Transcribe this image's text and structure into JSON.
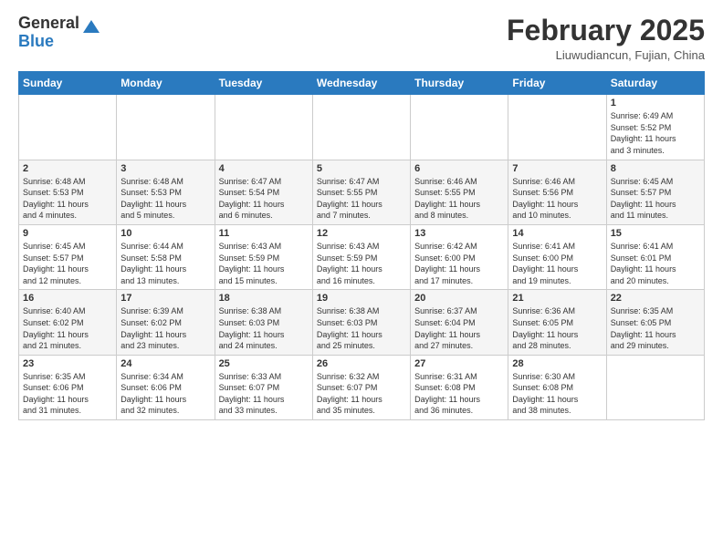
{
  "header": {
    "logo_line1": "General",
    "logo_line2": "Blue",
    "month_title": "February 2025",
    "location": "Liuwudiancun, Fujian, China"
  },
  "days_of_week": [
    "Sunday",
    "Monday",
    "Tuesday",
    "Wednesday",
    "Thursday",
    "Friday",
    "Saturday"
  ],
  "weeks": [
    [
      {
        "num": "",
        "info": ""
      },
      {
        "num": "",
        "info": ""
      },
      {
        "num": "",
        "info": ""
      },
      {
        "num": "",
        "info": ""
      },
      {
        "num": "",
        "info": ""
      },
      {
        "num": "",
        "info": ""
      },
      {
        "num": "1",
        "info": "Sunrise: 6:49 AM\nSunset: 5:52 PM\nDaylight: 11 hours\nand 3 minutes."
      }
    ],
    [
      {
        "num": "2",
        "info": "Sunrise: 6:48 AM\nSunset: 5:53 PM\nDaylight: 11 hours\nand 4 minutes."
      },
      {
        "num": "3",
        "info": "Sunrise: 6:48 AM\nSunset: 5:53 PM\nDaylight: 11 hours\nand 5 minutes."
      },
      {
        "num": "4",
        "info": "Sunrise: 6:47 AM\nSunset: 5:54 PM\nDaylight: 11 hours\nand 6 minutes."
      },
      {
        "num": "5",
        "info": "Sunrise: 6:47 AM\nSunset: 5:55 PM\nDaylight: 11 hours\nand 7 minutes."
      },
      {
        "num": "6",
        "info": "Sunrise: 6:46 AM\nSunset: 5:55 PM\nDaylight: 11 hours\nand 8 minutes."
      },
      {
        "num": "7",
        "info": "Sunrise: 6:46 AM\nSunset: 5:56 PM\nDaylight: 11 hours\nand 10 minutes."
      },
      {
        "num": "8",
        "info": "Sunrise: 6:45 AM\nSunset: 5:57 PM\nDaylight: 11 hours\nand 11 minutes."
      }
    ],
    [
      {
        "num": "9",
        "info": "Sunrise: 6:45 AM\nSunset: 5:57 PM\nDaylight: 11 hours\nand 12 minutes."
      },
      {
        "num": "10",
        "info": "Sunrise: 6:44 AM\nSunset: 5:58 PM\nDaylight: 11 hours\nand 13 minutes."
      },
      {
        "num": "11",
        "info": "Sunrise: 6:43 AM\nSunset: 5:59 PM\nDaylight: 11 hours\nand 15 minutes."
      },
      {
        "num": "12",
        "info": "Sunrise: 6:43 AM\nSunset: 5:59 PM\nDaylight: 11 hours\nand 16 minutes."
      },
      {
        "num": "13",
        "info": "Sunrise: 6:42 AM\nSunset: 6:00 PM\nDaylight: 11 hours\nand 17 minutes."
      },
      {
        "num": "14",
        "info": "Sunrise: 6:41 AM\nSunset: 6:00 PM\nDaylight: 11 hours\nand 19 minutes."
      },
      {
        "num": "15",
        "info": "Sunrise: 6:41 AM\nSunset: 6:01 PM\nDaylight: 11 hours\nand 20 minutes."
      }
    ],
    [
      {
        "num": "16",
        "info": "Sunrise: 6:40 AM\nSunset: 6:02 PM\nDaylight: 11 hours\nand 21 minutes."
      },
      {
        "num": "17",
        "info": "Sunrise: 6:39 AM\nSunset: 6:02 PM\nDaylight: 11 hours\nand 23 minutes."
      },
      {
        "num": "18",
        "info": "Sunrise: 6:38 AM\nSunset: 6:03 PM\nDaylight: 11 hours\nand 24 minutes."
      },
      {
        "num": "19",
        "info": "Sunrise: 6:38 AM\nSunset: 6:03 PM\nDaylight: 11 hours\nand 25 minutes."
      },
      {
        "num": "20",
        "info": "Sunrise: 6:37 AM\nSunset: 6:04 PM\nDaylight: 11 hours\nand 27 minutes."
      },
      {
        "num": "21",
        "info": "Sunrise: 6:36 AM\nSunset: 6:05 PM\nDaylight: 11 hours\nand 28 minutes."
      },
      {
        "num": "22",
        "info": "Sunrise: 6:35 AM\nSunset: 6:05 PM\nDaylight: 11 hours\nand 29 minutes."
      }
    ],
    [
      {
        "num": "23",
        "info": "Sunrise: 6:35 AM\nSunset: 6:06 PM\nDaylight: 11 hours\nand 31 minutes."
      },
      {
        "num": "24",
        "info": "Sunrise: 6:34 AM\nSunset: 6:06 PM\nDaylight: 11 hours\nand 32 minutes."
      },
      {
        "num": "25",
        "info": "Sunrise: 6:33 AM\nSunset: 6:07 PM\nDaylight: 11 hours\nand 33 minutes."
      },
      {
        "num": "26",
        "info": "Sunrise: 6:32 AM\nSunset: 6:07 PM\nDaylight: 11 hours\nand 35 minutes."
      },
      {
        "num": "27",
        "info": "Sunrise: 6:31 AM\nSunset: 6:08 PM\nDaylight: 11 hours\nand 36 minutes."
      },
      {
        "num": "28",
        "info": "Sunrise: 6:30 AM\nSunset: 6:08 PM\nDaylight: 11 hours\nand 38 minutes."
      },
      {
        "num": "",
        "info": ""
      }
    ]
  ]
}
